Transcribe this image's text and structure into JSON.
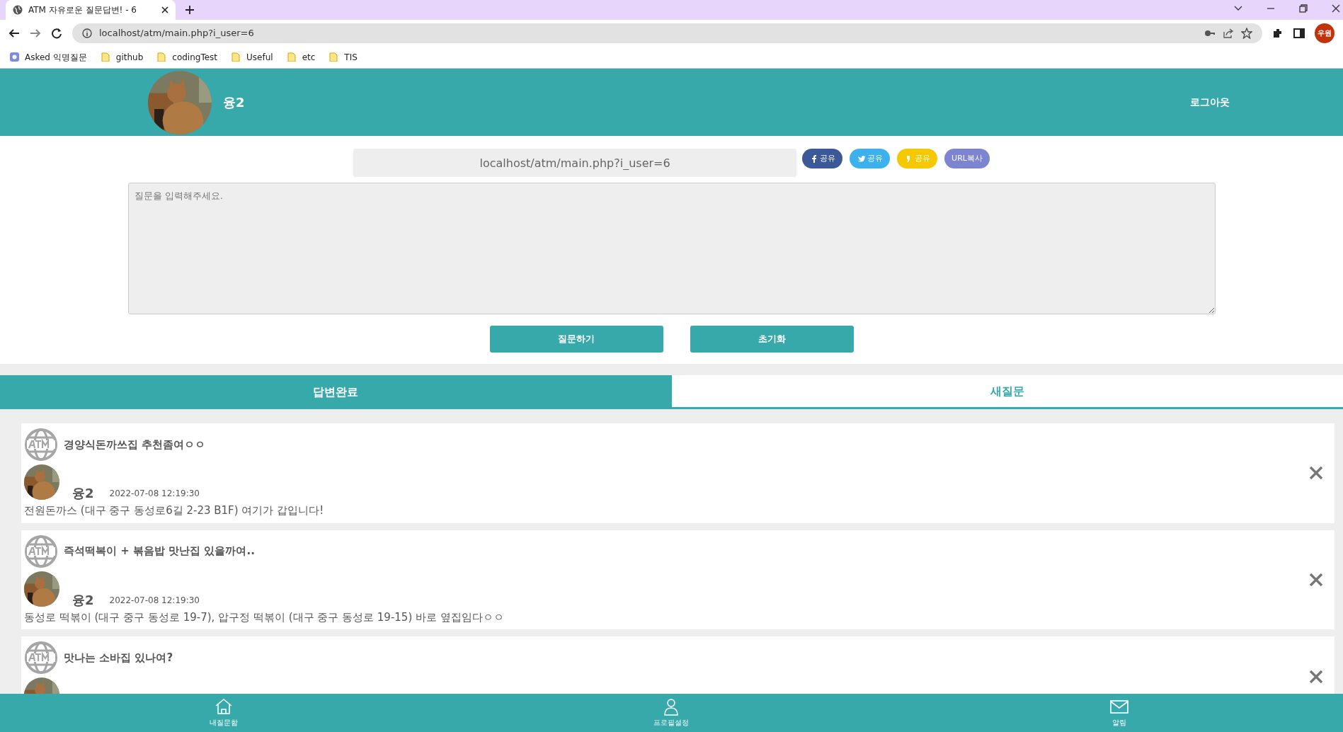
{
  "browser": {
    "tabs": [
      {
        "title": "ATM 자유로운 질문답변! - 6",
        "selected": true
      }
    ],
    "address": "localhost/atm/main.php?i_user=6",
    "profile": "우원",
    "bookmarks": [
      {
        "label": "Asked 익명질문",
        "kind": "site"
      },
      {
        "label": "github",
        "kind": "folder"
      },
      {
        "label": "codingTest",
        "kind": "folder"
      },
      {
        "label": "Useful",
        "kind": "folder"
      },
      {
        "label": "etc",
        "kind": "folder"
      },
      {
        "label": "TIS",
        "kind": "folder"
      }
    ]
  },
  "header": {
    "username": "융2",
    "logout": "로그아웃"
  },
  "share": {
    "url": "localhost/atm/main.php?i_user=6",
    "buttons": [
      {
        "label": "공유",
        "kind": "facebook"
      },
      {
        "label": "공유",
        "kind": "twitter"
      },
      {
        "label": "공유",
        "kind": "kakao"
      },
      {
        "label": "URL복사",
        "kind": "url"
      }
    ]
  },
  "question": {
    "placeholder": "질문을 입력해주세요.",
    "buttons": [
      "질문하기",
      "초기화"
    ]
  },
  "tabs": [
    {
      "label": "답변완료",
      "selected": true
    },
    {
      "label": "새질문",
      "selected": false
    }
  ],
  "questions": [
    {
      "title": "경양식돈까쓰집 추천좀여ㅇㅇ",
      "author": "융2",
      "date": "2022-07-08 12:19:30",
      "answer": "전원돈까스 (대구 중구 동성로6길 2-23 B1F) 여기가 갑입니다!"
    },
    {
      "title": "즉석떡복이 + 볶음밥 맛난집 있을까여..",
      "author": "융2",
      "date": "2022-07-08 12:19:30",
      "answer": "동성로 떡볶이 (대구 중구 동성로 19-7), 압구정 떡볶이 (대구 중구 동성로 19-15) 바로 옆집임다ㅇㅇ"
    },
    {
      "title": "맛나는 소바집 있나여?"
    }
  ],
  "bottom_nav": [
    {
      "label": "내질문함",
      "kind": "home"
    },
    {
      "label": "프로필설정",
      "kind": "person"
    },
    {
      "label": "알림",
      "kind": "mail"
    }
  ]
}
